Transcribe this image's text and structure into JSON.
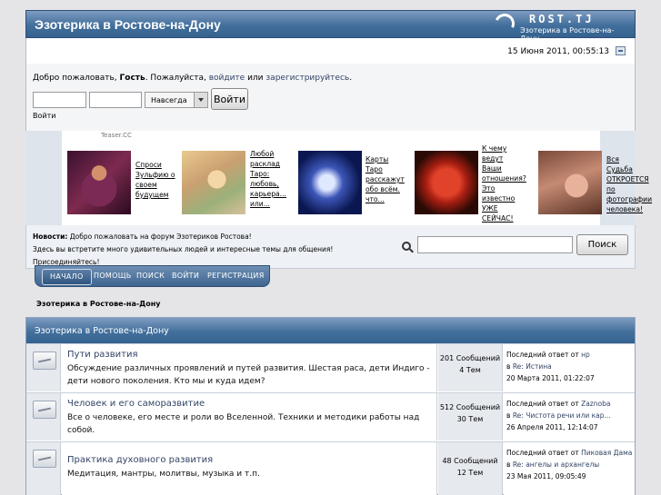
{
  "header": {
    "site_title": "Эзотерика в Ростове-на-Дону",
    "logo_name": "ROST.TJ",
    "logo_sub": "Эзотерика в Ростове-на-Дону"
  },
  "userbar": {
    "datetime": "15 Июня 2011, 00:55:13"
  },
  "login": {
    "welcome_prefix": "Добро пожаловать, ",
    "guest": "Гость",
    "welcome_mid": ". Пожалуйста, ",
    "login_link": "войдите",
    "or": " или ",
    "register_link": "зарегистрируйтесь",
    "period": ".",
    "duration": "Навсегда",
    "button": "Войти",
    "label": "Войти"
  },
  "teaser": {
    "label": "Teaser.CC",
    "items": [
      {
        "text": "Спроси Зульфию о своем будущем"
      },
      {
        "text": "Любой расклад Таро: любовь, карьера... или..."
      },
      {
        "text": "Карты Таро расскажут обо всём. что..."
      },
      {
        "text": "К чему ведут Ваши отношения? Это известно УЖЕ СЕЙЧАС!"
      },
      {
        "text": "Вся Судьба ОТКРОЕТСЯ по фотографии человека!"
      }
    ]
  },
  "news": {
    "label": "Новости:",
    "line1": " Добро пожаловать на форум Эзотериков Ростова!",
    "line2": "Здесь вы встретите много удивительных людей и интересные темы для общения!",
    "line3": "Присоединяйтесь!",
    "search_button": "Поиск"
  },
  "nav": {
    "items": [
      "НАЧАЛО",
      "ПОМОЩЬ",
      "ПОИСК",
      "ВОЙТИ",
      "РЕГИСТРАЦИЯ"
    ]
  },
  "breadcrumb": "Эзотерика в Ростове-на-Дону",
  "category": {
    "title": "Эзотерика в Ростове-на-Дону",
    "boards": [
      {
        "title": "Пути развития",
        "desc": "Обсуждение различных проявлений и путей развития. Шестая раса, дети Индиго - дети нового поколения. Кто мы и куда идем?",
        "posts": "201 Сообщений",
        "topics": "4 Тем",
        "last_prefix": "Последний ответ",
        "last_from": " от ",
        "last_user": "нр",
        "last_in": "в ",
        "last_topic": "Re: Истина",
        "last_date": "20 Марта 2011, 01:22:07"
      },
      {
        "title": "Человек и его саморазвитие",
        "desc": "Все о человеке, его месте и роли во Вселенной. Техники и методики работы над собой.",
        "posts": "512 Сообщений",
        "topics": "30 Тем",
        "last_prefix": "Последний ответ",
        "last_from": " от ",
        "last_user": "Zaznoba",
        "last_in": "в ",
        "last_topic": "Re: Чистота речи или кар...",
        "last_date": "26 Апреля 2011, 12:14:07"
      },
      {
        "title": "Практика духовного развития",
        "desc": "Медитация, мантры, молитвы, музыка и т.п.",
        "posts": "48 Сообщений",
        "topics": "12 Тем",
        "last_prefix": "Последний ответ",
        "last_from": " от ",
        "last_user": "Пиковая Дама",
        "last_in": "в ",
        "last_topic": "Re: ангелы и архангелы",
        "last_date": "23 Мая 2011, 09:05:49"
      }
    ]
  }
}
